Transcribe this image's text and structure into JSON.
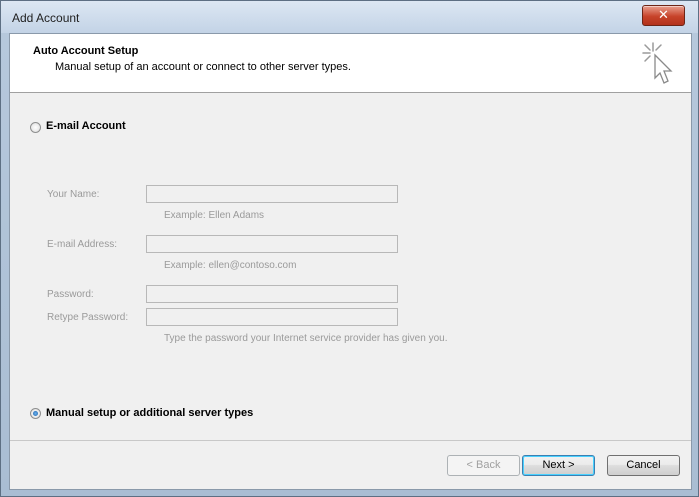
{
  "window": {
    "title": "Add Account",
    "close_glyph": "✕"
  },
  "header": {
    "title": "Auto Account Setup",
    "subtitle": "Manual setup of an account or connect to other server types.",
    "icon": "wizard-cursor-icon"
  },
  "options": {
    "email_account": {
      "label": "E-mail Account",
      "selected": false
    },
    "manual_setup": {
      "label": "Manual setup or additional server types",
      "selected": true
    }
  },
  "form": {
    "your_name": {
      "label": "Your Name:",
      "value": "",
      "hint": "Example: Ellen Adams"
    },
    "email_address": {
      "label": "E-mail Address:",
      "value": "",
      "hint": "Example: ellen@contoso.com"
    },
    "password": {
      "label": "Password:",
      "value": ""
    },
    "retype_password": {
      "label": "Retype Password:",
      "value": ""
    },
    "password_hint": "Type the password your Internet service provider has given you."
  },
  "buttons": {
    "back": "< Back",
    "next": "Next >",
    "cancel": "Cancel"
  }
}
